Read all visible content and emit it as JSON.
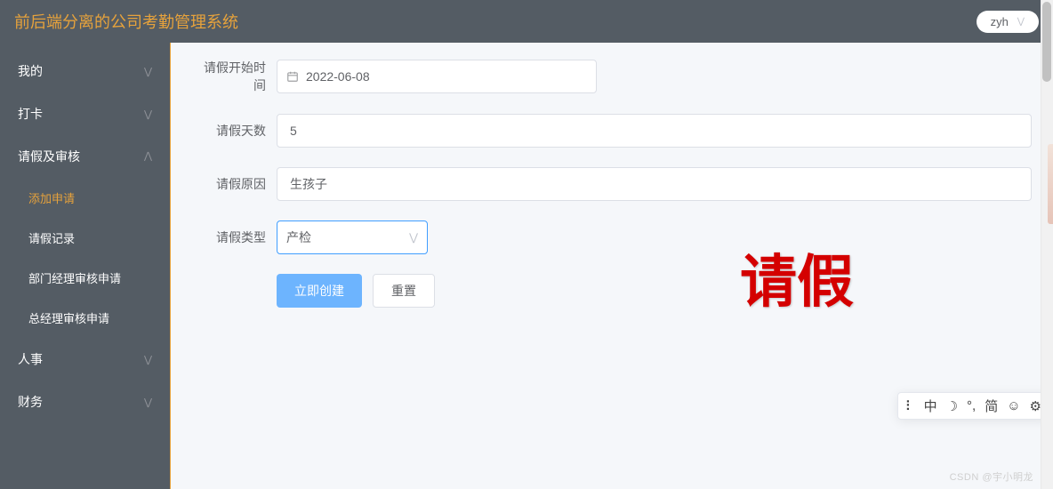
{
  "header": {
    "title": "前后端分离的公司考勤管理系统",
    "user": "zyh"
  },
  "sidebar": {
    "items": [
      {
        "label": "我的",
        "open": false
      },
      {
        "label": "打卡",
        "open": false
      },
      {
        "label": "请假及审核",
        "open": true,
        "children": [
          {
            "label": "添加申请",
            "active": true
          },
          {
            "label": "请假记录",
            "active": false
          },
          {
            "label": "部门经理审核申请",
            "active": false
          },
          {
            "label": "总经理审核申请",
            "active": false
          }
        ]
      },
      {
        "label": "人事",
        "open": false
      },
      {
        "label": "财务",
        "open": false
      }
    ]
  },
  "form": {
    "start_date_label": "请假开始时间",
    "start_date_value": "2022-06-08",
    "days_label": "请假天数",
    "days_value": "5",
    "reason_label": "请假原因",
    "reason_value": "生孩子",
    "type_label": "请假类型",
    "type_value": "产检",
    "submit": "立即创建",
    "reset": "重置"
  },
  "watermark": "请假",
  "floatbar": {
    "divider": "⠇",
    "lang": "中",
    "moon": "☽",
    "deg": "°,",
    "script": "简",
    "smile": "☺",
    "gear": "⚙"
  },
  "csdn": "CSDN @宇小明龙"
}
